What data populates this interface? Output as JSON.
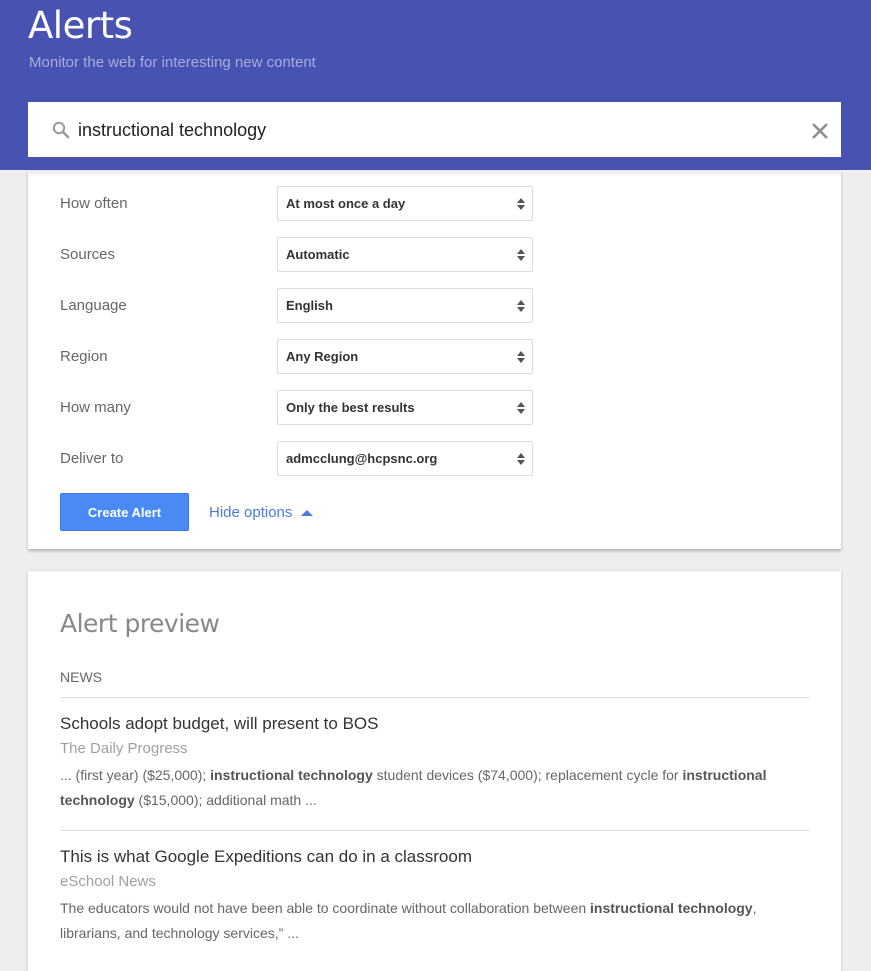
{
  "header": {
    "title": "Alerts",
    "subtitle": "Monitor the web for interesting new content"
  },
  "search": {
    "value": "instructional technology",
    "icon": "search-icon",
    "clear_icon": "close-icon"
  },
  "options": [
    {
      "label": "How often",
      "value": "At most once a day"
    },
    {
      "label": "Sources",
      "value": "Automatic"
    },
    {
      "label": "Language",
      "value": "English"
    },
    {
      "label": "Region",
      "value": "Any Region"
    },
    {
      "label": "How many",
      "value": "Only the best results"
    },
    {
      "label": "Deliver to",
      "value": "admcclung@hcpsnc.org"
    }
  ],
  "actions": {
    "create_label": "Create Alert",
    "hide_options_label": "Hide options"
  },
  "preview": {
    "title": "Alert preview",
    "section": "NEWS",
    "items": [
      {
        "title": "Schools adopt budget, will present to BOS",
        "source": "The Daily Progress",
        "snippet": [
          {
            "text": "... (first year) ($25,000); ",
            "bold": false
          },
          {
            "text": "instructional technology",
            "bold": true
          },
          {
            "text": " student devices ($74,000); replacement cycle for ",
            "bold": false
          },
          {
            "text": "instructional technology",
            "bold": true
          },
          {
            "text": " ($15,000); additional math ...",
            "bold": false
          }
        ]
      },
      {
        "title": "This is what Google Expeditions can do in a classroom",
        "source": "eSchool News",
        "snippet": [
          {
            "text": "The educators would not have been able to coordinate without collaboration between ",
            "bold": false
          },
          {
            "text": "instructional technology",
            "bold": true
          },
          {
            "text": ", librarians, and technology services,” ...",
            "bold": false
          }
        ]
      }
    ]
  },
  "colors": {
    "header_bg": "#4752b1",
    "primary_button": "#4a8af4",
    "link": "#4a7bd8"
  }
}
